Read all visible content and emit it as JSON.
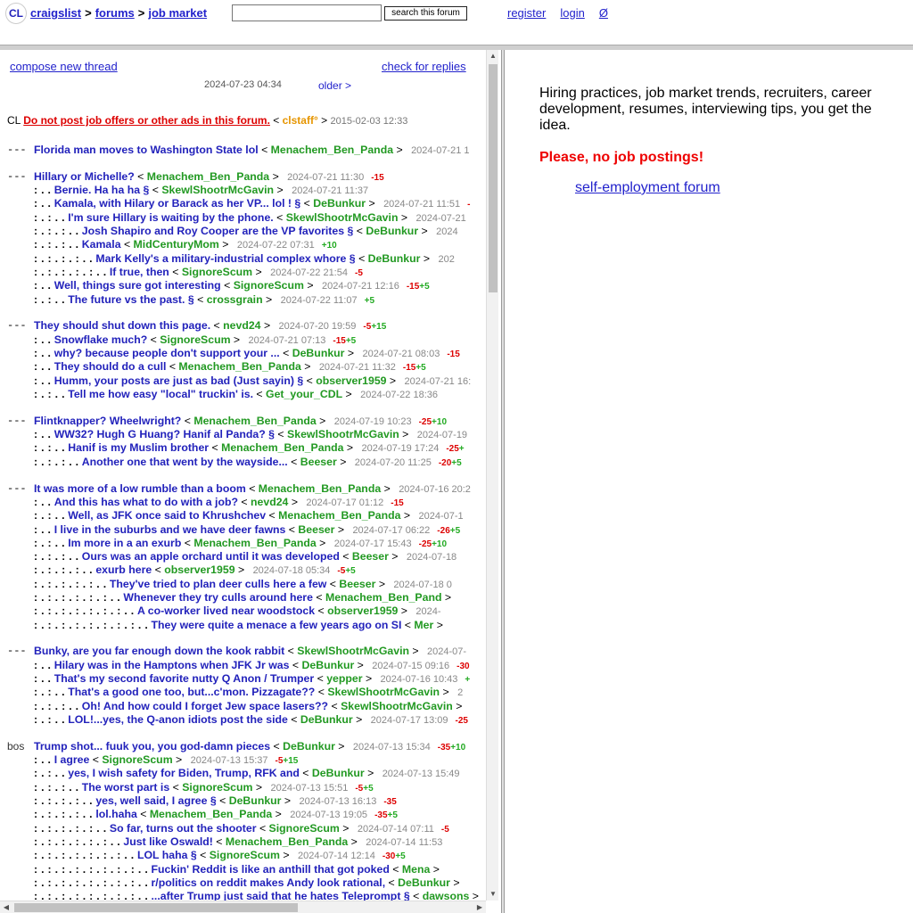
{
  "header": {
    "logo": "CL",
    "breadcrumb": [
      "craigslist",
      "forums",
      "job market"
    ],
    "search_placeholder": "",
    "search_button": "search this forum",
    "links": [
      "register",
      "login",
      "Ø"
    ]
  },
  "left": {
    "compose": "compose new thread",
    "check_replies": "check for replies",
    "list_date": "2024-07-23 04:34",
    "older": "older >",
    "cl_notice": {
      "prefix": "CL",
      "text": "Do not post job offers or other ads in this forum.",
      "user": "clstaff°",
      "date": "2015-02-03 12:33"
    },
    "threads": [
      {
        "lead": "---",
        "rows": [
          {
            "dots": "",
            "title": "Florida man moves to Washington State lol",
            "user": "Menachem_Ben_Panda",
            "date": "2024-07-21 1",
            "neg": "",
            "pos": ""
          }
        ]
      },
      {
        "lead": "---",
        "rows": [
          {
            "dots": "",
            "title": "Hillary or Michelle?",
            "user": "Menachem_Ben_Panda",
            "date": "2024-07-21 11:30",
            "neg": "-15",
            "pos": ""
          },
          {
            "dots": ": . .",
            "title": "Bernie. Ha ha ha §",
            "user": "SkewlShootrMcGavin",
            "date": "2024-07-21 11:37",
            "neg": "",
            "pos": ""
          },
          {
            "dots": ": . .",
            "title": "Kamala, with Hilary or Barack as her VP... lol ! §",
            "user": "DeBunkur",
            "date": "2024-07-21 11:51",
            "neg": "-",
            "pos": ""
          },
          {
            "dots": ": . : . .",
            "title": "I'm sure Hillary is waiting by the phone.",
            "user": "SkewlShootrMcGavin",
            "date": "2024-07-21",
            "neg": "",
            "pos": ""
          },
          {
            "dots": ": . : . : . .",
            "title": "Josh Shapiro and Roy Cooper are the VP favorites §",
            "user": "DeBunkur",
            "date": "2024",
            "neg": "",
            "pos": ""
          },
          {
            "dots": ": . : . : . .",
            "title": "Kamala",
            "user": "MidCenturyMom",
            "date": "2024-07-22 07:31",
            "neg": "",
            "pos": "+10"
          },
          {
            "dots": ": . : . : . : . .",
            "title": "Mark Kelly's a military-industrial complex whore §",
            "user": "DeBunkur",
            "date": "202",
            "neg": "",
            "pos": ""
          },
          {
            "dots": ": . : . : . : . : . .",
            "title": "If true, then",
            "user": "SignoreScum",
            "date": "2024-07-22 21:54",
            "neg": "-5",
            "pos": ""
          },
          {
            "dots": ": . .",
            "title": "Well, things sure got interesting",
            "user": "SignoreScum",
            "date": "2024-07-21 12:16",
            "neg": "-15",
            "pos": "+5"
          },
          {
            "dots": ": . : . .",
            "title": "The future vs the past. §",
            "user": "crossgrain",
            "date": "2024-07-22 11:07",
            "neg": "",
            "pos": "+5"
          }
        ]
      },
      {
        "lead": "---",
        "rows": [
          {
            "dots": "",
            "title": "They should shut down this page.",
            "user": "nevd24",
            "date": "2024-07-20 19:59",
            "neg": "-5",
            "pos": "+15"
          },
          {
            "dots": ": . .",
            "title": "Snowflake much?",
            "user": "SignoreScum",
            "date": "2024-07-21 07:13",
            "neg": "-15",
            "pos": "+5"
          },
          {
            "dots": ": . .",
            "title": "why? because people don't support your ...",
            "user": "DeBunkur",
            "date": "2024-07-21 08:03",
            "neg": "-15",
            "pos": ""
          },
          {
            "dots": ": . .",
            "title": "They should do a cull",
            "user": "Menachem_Ben_Panda",
            "date": "2024-07-21 11:32",
            "neg": "-15",
            "pos": "+5"
          },
          {
            "dots": ": . .",
            "title": "Humm, your posts are just as bad (Just sayin) §",
            "user": "observer1959",
            "date": "2024-07-21 16:",
            "neg": "",
            "pos": ""
          },
          {
            "dots": ": . : . .",
            "title": "Tell me how easy \"local\" truckin' is.",
            "user": "Get_your_CDL",
            "date": "2024-07-22 18:36",
            "neg": "",
            "pos": ""
          }
        ]
      },
      {
        "lead": "---",
        "rows": [
          {
            "dots": "",
            "title": "Flintknapper? Wheelwright?",
            "user": "Menachem_Ben_Panda",
            "date": "2024-07-19 10:23",
            "neg": "-25",
            "pos": "+10"
          },
          {
            "dots": ": . .",
            "title": "WW32? Hugh G Huang? Hanif al Panda? §",
            "user": "SkewlShootrMcGavin",
            "date": "2024-07-19",
            "neg": "",
            "pos": ""
          },
          {
            "dots": ": . : . .",
            "title": "Hanif is my Muslim brother",
            "user": "Menachem_Ben_Panda",
            "date": "2024-07-19 17:24",
            "neg": "-25",
            "pos": "+"
          },
          {
            "dots": ": . : . : . .",
            "title": "Another one that went by the wayside...",
            "user": "Beeser",
            "date": "2024-07-20 11:25",
            "neg": "-20",
            "pos": "+5"
          }
        ]
      },
      {
        "lead": "---",
        "rows": [
          {
            "dots": "",
            "title": "It was more of a low rumble than a boom",
            "user": "Menachem_Ben_Panda",
            "date": "2024-07-16 20:2",
            "neg": "",
            "pos": ""
          },
          {
            "dots": ": . .",
            "title": "And this has what to do with a job?",
            "user": "nevd24",
            "date": "2024-07-17 01:12",
            "neg": "-15",
            "pos": ""
          },
          {
            "dots": ": . : . .",
            "title": "Well, as JFK once said to Khrushchev",
            "user": "Menachem_Ben_Panda",
            "date": "2024-07-1",
            "neg": "",
            "pos": ""
          },
          {
            "dots": ": . .",
            "title": "I live in the suburbs and we have deer fawns",
            "user": "Beeser",
            "date": "2024-07-17 06:22",
            "neg": "-26",
            "pos": "+5"
          },
          {
            "dots": ": . : . .",
            "title": "Im more in a an exurb",
            "user": "Menachem_Ben_Panda",
            "date": "2024-07-17 15:43",
            "neg": "-25",
            "pos": "+10"
          },
          {
            "dots": ": . : . : . .",
            "title": "Ours was an apple orchard until it was developed",
            "user": "Beeser",
            "date": "2024-07-18",
            "neg": "",
            "pos": ""
          },
          {
            "dots": ": . : . : . : . .",
            "title": "exurb here",
            "user": "observer1959",
            "date": "2024-07-18 05:34",
            "neg": "-5",
            "pos": "+5"
          },
          {
            "dots": ": . : . : . : . : . .",
            "title": "They've tried to plan deer culls here a few",
            "user": "Beeser",
            "date": "2024-07-18 0",
            "neg": "",
            "pos": ""
          },
          {
            "dots": ": . : . : . : . : . : . .",
            "title": "Whenever they try culls around here",
            "user": "Menachem_Ben_Pand",
            "date": "",
            "neg": "",
            "pos": ""
          },
          {
            "dots": ": . : . : . : . : . : . : . .",
            "title": "A co-worker lived near woodstock",
            "user": "observer1959",
            "date": "2024-",
            "neg": "",
            "pos": ""
          },
          {
            "dots": ": . : . : . : . : . : . : . : . .",
            "title": "They were quite a menace a few years ago on SI",
            "user": "Mer",
            "date": "",
            "neg": "",
            "pos": ""
          }
        ]
      },
      {
        "lead": "---",
        "rows": [
          {
            "dots": "",
            "title": "Bunky, are you far enough down the kook rabbit",
            "user": "SkewlShootrMcGavin",
            "date": "2024-07-",
            "neg": "",
            "pos": ""
          },
          {
            "dots": ": . .",
            "title": "Hilary was in the Hamptons when JFK Jr was",
            "user": "DeBunkur",
            "date": "2024-07-15 09:16",
            "neg": "-30",
            "pos": ""
          },
          {
            "dots": ": . .",
            "title": "That's my second favorite nutty Q Anon / Trumper",
            "user": "yepper",
            "date": "2024-07-16 10:43",
            "neg": "",
            "pos": "+"
          },
          {
            "dots": ": . : . .",
            "title": "That's a good one too, but...c'mon. Pizzagate??",
            "user": "SkewlShootrMcGavin",
            "date": "2",
            "neg": "",
            "pos": ""
          },
          {
            "dots": ": . : . : . .",
            "title": "Oh! And how could I forget Jew space lasers??",
            "user": "SkewlShootrMcGavin",
            "date": "",
            "neg": "",
            "pos": ""
          },
          {
            "dots": ": . : . .",
            "title": "LOL!...yes, the Q-anon idiots post the side",
            "user": "DeBunkur",
            "date": "2024-07-17 13:09",
            "neg": "-25",
            "pos": ""
          }
        ]
      },
      {
        "lead": "bos",
        "rows": [
          {
            "dots": "",
            "title": "Trump shot... fuuk you, you god-damn pieces",
            "user": "DeBunkur",
            "date": "2024-07-13 15:34",
            "neg": "-35",
            "pos": "+10"
          },
          {
            "dots": ": . .",
            "title": "I agree",
            "user": "SignoreScum",
            "date": "2024-07-13 15:37",
            "neg": "-5",
            "pos": "+15"
          },
          {
            "dots": ": . : . .",
            "title": "yes, I wish safety for Biden, Trump, RFK and",
            "user": "DeBunkur",
            "date": "2024-07-13 15:49",
            "neg": "",
            "pos": ""
          },
          {
            "dots": ": . : . : . .",
            "title": "The worst part is",
            "user": "SignoreScum",
            "date": "2024-07-13 15:51",
            "neg": "-5",
            "pos": "+5"
          },
          {
            "dots": ": . : . : . : . .",
            "title": "yes, well said, I agree §",
            "user": "DeBunkur",
            "date": "2024-07-13 16:13",
            "neg": "-35",
            "pos": ""
          },
          {
            "dots": ": . : . : . : . .",
            "title": "lol.haha",
            "user": "Menachem_Ben_Panda",
            "date": "2024-07-13 19:05",
            "neg": "-35",
            "pos": "+5"
          },
          {
            "dots": ": . : . : . : . : . .",
            "title": "So far, turns out the shooter",
            "user": "SignoreScum",
            "date": "2024-07-14 07:11",
            "neg": "-5",
            "pos": ""
          },
          {
            "dots": ": . : . : . : . : . : . .",
            "title": "Just like Oswald!",
            "user": "Menachem_Ben_Panda",
            "date": "2024-07-14 11:53",
            "neg": "",
            "pos": ""
          },
          {
            "dots": ": . : . : . : . : . : . : . .",
            "title": "LOL haha §",
            "user": "SignoreScum",
            "date": "2024-07-14 12:14",
            "neg": "-30",
            "pos": "+5"
          },
          {
            "dots": ": . : . : . : . : . : . : . : . .",
            "title": "Fuckin' Reddit is like an anthill that got poked",
            "user": "Mena",
            "date": "",
            "neg": "",
            "pos": ""
          },
          {
            "dots": ": . : . : . : . : . : . : . : . .",
            "title": "r/politics on reddit makes Andy look rational,",
            "user": "DeBunkur",
            "date": "",
            "neg": "",
            "pos": ""
          },
          {
            "dots": ": . : . : . : . : . : . : . : . .",
            "title": "...after Trump just said that he hates Teleprompt §",
            "user": "dawsons",
            "date": "",
            "neg": "",
            "pos": ""
          }
        ]
      }
    ]
  },
  "right": {
    "description": "Hiring practices, job market trends, recruiters, career development, resumes, interviewing tips, you get the idea.",
    "warning": "Please, no job postings!",
    "link": "self-employment forum"
  },
  "colors": {
    "title_link": "#2222bb",
    "username": "#229922",
    "warning": "#ee0000",
    "staff": "#e69500"
  }
}
